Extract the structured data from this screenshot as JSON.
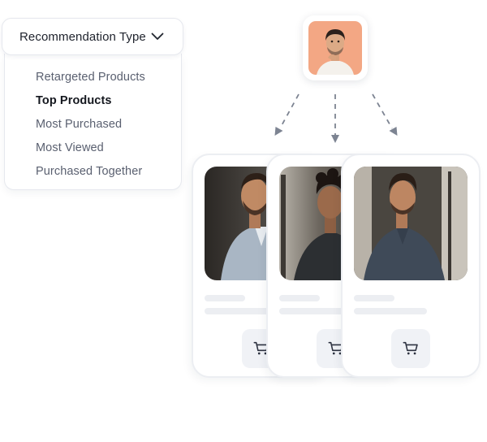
{
  "dropdown": {
    "title": "Recommendation Type",
    "chevron_icon": "chevron-down-icon",
    "options": [
      {
        "label": "Retargeted Products",
        "selected": false
      },
      {
        "label": "Top Products",
        "selected": true
      },
      {
        "label": "Most Purchased",
        "selected": false
      },
      {
        "label": "Most Viewed",
        "selected": false
      },
      {
        "label": "Purchased Together",
        "selected": false
      }
    ]
  },
  "user": {
    "avatar_icon": "user-avatar",
    "avatar_bg": "#f3a784"
  },
  "cards": [
    {
      "photo": "product-photo",
      "cart_icon": "cart-icon"
    },
    {
      "photo": "product-photo",
      "cart_icon": "cart-icon"
    },
    {
      "photo": "product-photo",
      "cart_icon": "cart-icon"
    }
  ],
  "colors": {
    "arrow": "#7d8492",
    "card_border": "#eceef2",
    "skeleton": "#eceef2",
    "cart_button_bg": "#f0f2f6",
    "cart_icon": "#2d3240"
  }
}
